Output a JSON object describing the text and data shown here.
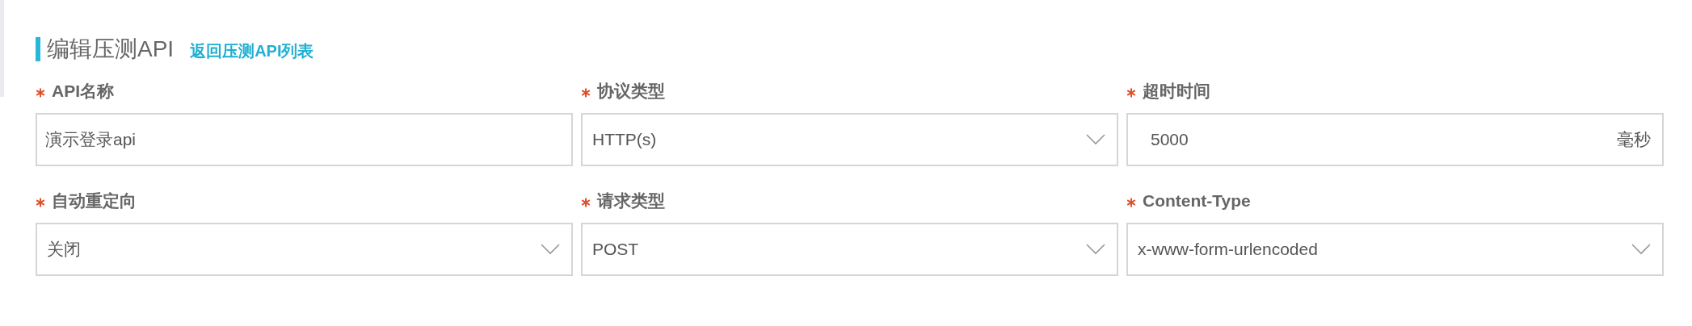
{
  "header": {
    "title": "编辑压测API",
    "back_link": "返回压测API列表"
  },
  "fields": [
    {
      "label": "API名称",
      "required": true,
      "kind": "text",
      "value": "演示登录api"
    },
    {
      "label": "协议类型",
      "required": true,
      "kind": "select",
      "value": "HTTP(s)"
    },
    {
      "label": "超时时间",
      "required": true,
      "kind": "unit",
      "value": "5000",
      "unit": "毫秒"
    },
    {
      "label": "自动重定向",
      "required": true,
      "kind": "select",
      "value": "关闭"
    },
    {
      "label": "请求类型",
      "required": true,
      "kind": "select",
      "value": "POST"
    },
    {
      "label": "Content-Type",
      "required": true,
      "kind": "select",
      "value": "x-www-form-urlencoded"
    }
  ]
}
